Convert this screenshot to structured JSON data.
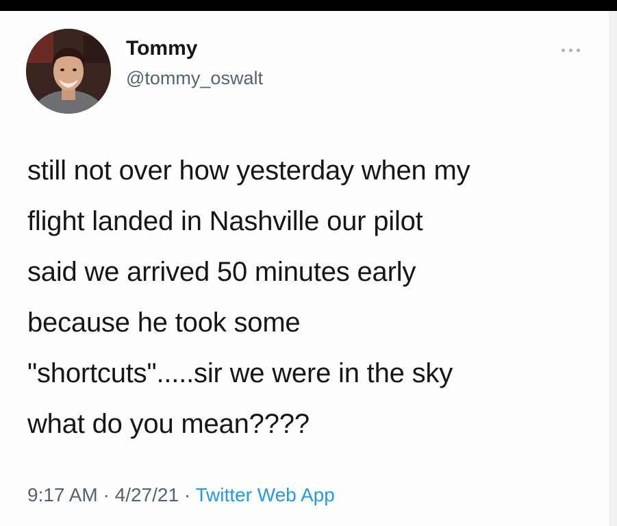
{
  "tweet": {
    "author": {
      "display_name": "Tommy",
      "handle": "@tommy_oswalt"
    },
    "more_icon": "more-horizontal-icon",
    "text_lines": [
      "still not over how yesterday when my",
      "flight landed in Nashville our pilot",
      "said we arrived 50 minutes early",
      "because he took some",
      "\"shortcuts\".....sir we were in the sky",
      "what do you mean????"
    ],
    "meta": {
      "time": "9:17 AM",
      "separator": "·",
      "date": "4/27/21",
      "source": "Twitter Web App"
    }
  },
  "colors": {
    "text": "#14171a",
    "secondary": "#536471",
    "link": "#1d9bf0",
    "top_bar": "#000000"
  }
}
